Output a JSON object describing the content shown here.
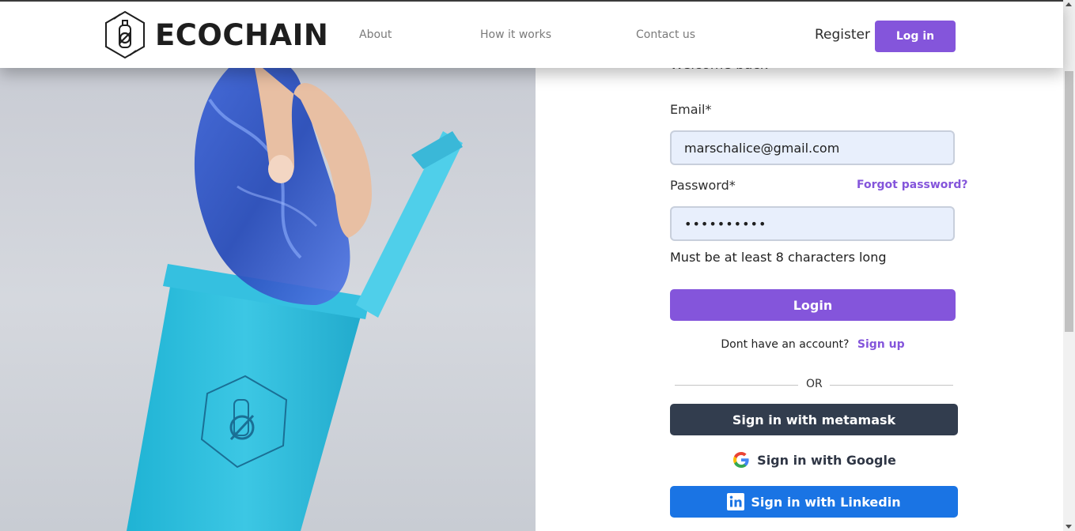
{
  "brand": {
    "name": "ECOCHAIN",
    "primary_color": "#8455db",
    "dark_color": "#323d4e",
    "linkedin_color": "#1a74e4"
  },
  "nav": {
    "items": [
      {
        "label": "About"
      },
      {
        "label": "How it works"
      },
      {
        "label": "Contact us"
      }
    ],
    "register_label": "Register",
    "login_label": "Log in"
  },
  "form": {
    "welcome": "Welcome back",
    "email_label": "Email*",
    "email_value": "marschalice@gmail.com",
    "password_label": "Password*",
    "password_value": "••••••••••",
    "forgot_label": "Forgot password?",
    "password_hint": "Must be at least 8 characters long",
    "login_button": "Login",
    "signup_prompt": "Dont have an account?",
    "signup_link": "Sign up",
    "or_text": "OR",
    "metamask_button": "Sign in with metamask",
    "google_button": "Sign in with Google",
    "linkedin_button": "Sign in with Linkedin"
  },
  "icons": {
    "logo": "recycle-bottle-icon",
    "google": "google-icon",
    "linkedin": "linkedin-icon"
  }
}
